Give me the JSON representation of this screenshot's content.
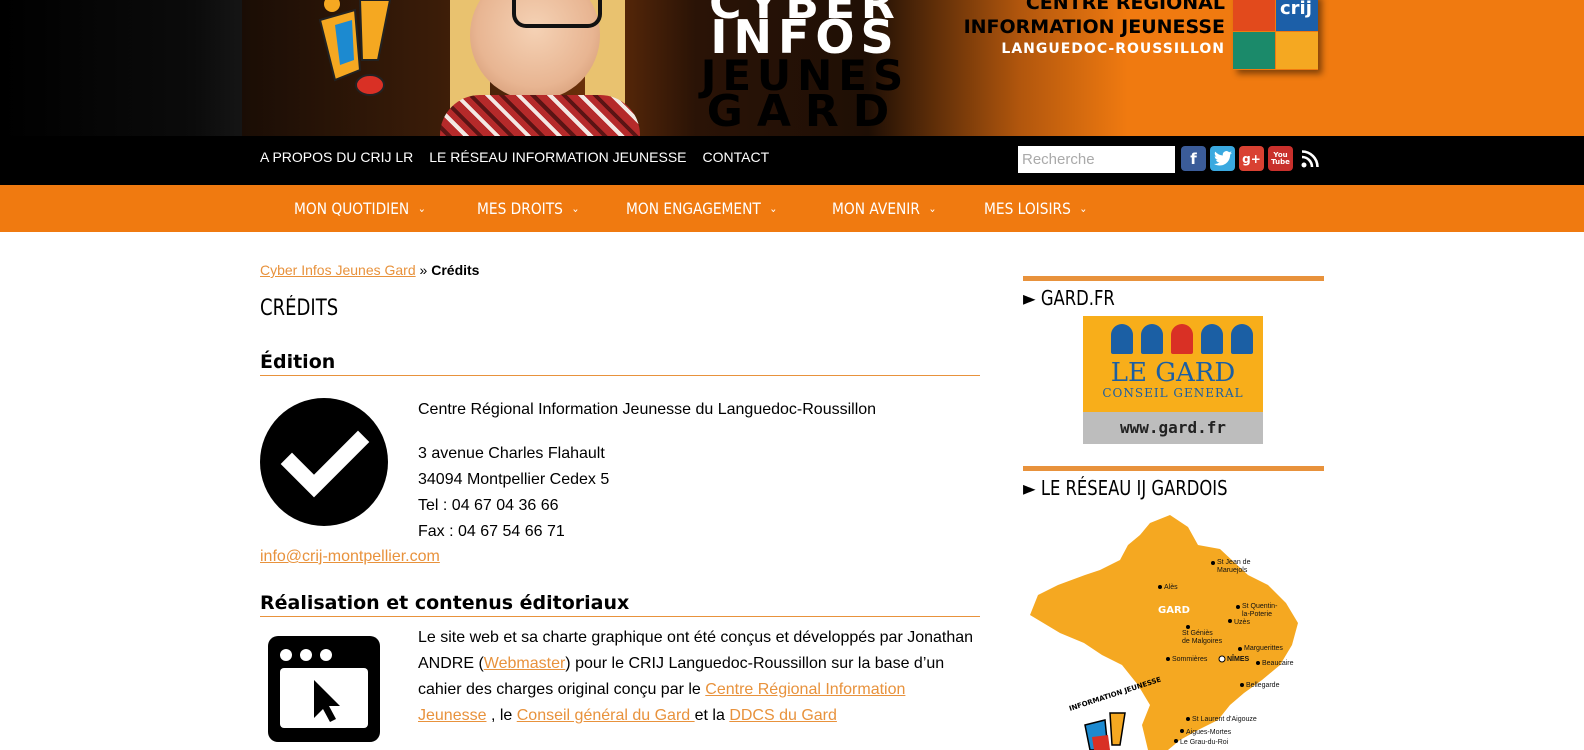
{
  "banner": {
    "logo_line1": "CYBER",
    "logo_line2": "INFOS",
    "logo_line3": "JEUNES",
    "logo_line4": "GARD",
    "crij_line1": "CENTRE RÉGIONAL",
    "crij_line2": "INFORMATION JEUNESSE",
    "crij_line3": "LANGUEDOC-ROUSSILLON",
    "crij_badge": "crij"
  },
  "topbar": {
    "links": [
      "A PROPOS DU CRIJ LR",
      "LE RÉSEAU INFORMATION JEUNESSE",
      "CONTACT"
    ],
    "search_placeholder": "Recherche",
    "socials": [
      "facebook-icon",
      "twitter-icon",
      "googleplus-icon",
      "youtube-icon",
      "rss-icon"
    ]
  },
  "nav": {
    "items": [
      "MON QUOTIDIEN",
      "MES DROITS",
      "MON ENGAGEMENT",
      "MON AVENIR",
      "MES LOISIRS"
    ]
  },
  "breadcrumb": {
    "home": "Cyber Infos Jeunes Gard",
    "separator": "»",
    "current": "Crédits"
  },
  "page": {
    "title": "CRÉDITS",
    "edition": {
      "heading": "Édition",
      "org": "Centre Régional Information Jeunesse du Languedoc-Roussillon",
      "address1": "3 avenue Charles Flahault",
      "address2": "34094 Montpellier Cedex 5",
      "tel": "Tel : 04 67 04 36 66",
      "fax": "Fax : 04 67 54 66 71",
      "email": "info@crij-montpellier.com"
    },
    "realisation": {
      "heading": "Réalisation et contenus éditoriaux",
      "text1": "Le site web et sa charte graphique ont été conçus et développés par Jonathan ANDRE (",
      "link_webmaster": "Webmaster",
      "text2": ") pour le CRIJ Languedoc-Roussillon sur la base d’un cahier des charges original conçu par le ",
      "link_crij": "Centre Régional Information Jeunesse",
      "text3": " , le ",
      "link_cg": "Conseil général du Gard ",
      "text4": "et la ",
      "link_ddcs": "DDCS du Gard"
    }
  },
  "sidebar": {
    "box1_title": "► GARD.FR",
    "gard_logo": {
      "name": "LE GARD",
      "sub": "CONSEIL GENERAL",
      "url": "www.gard.fr"
    },
    "box2_title": "► LE RÉSEAU IJ GARDOIS",
    "map": {
      "region": "GARD",
      "towns": [
        "St Jean de",
        "Maruejols",
        "Alès",
        "St Quentin-",
        "la-Poterie",
        "Uzès",
        "St Géniès",
        "de Malgoires",
        "Marguerittes",
        "Sommières",
        "NÎMES",
        "Beaucaire",
        "Bellegarde",
        "St Laurent d'Aigouze",
        "Aigues-Mortes",
        "Le Grau-du-Roi"
      ],
      "badge_text": "INFORMATION JEUNESSE"
    }
  },
  "colors": {
    "orange": "#f07a10",
    "link": "#e8923c",
    "black": "#000000"
  }
}
